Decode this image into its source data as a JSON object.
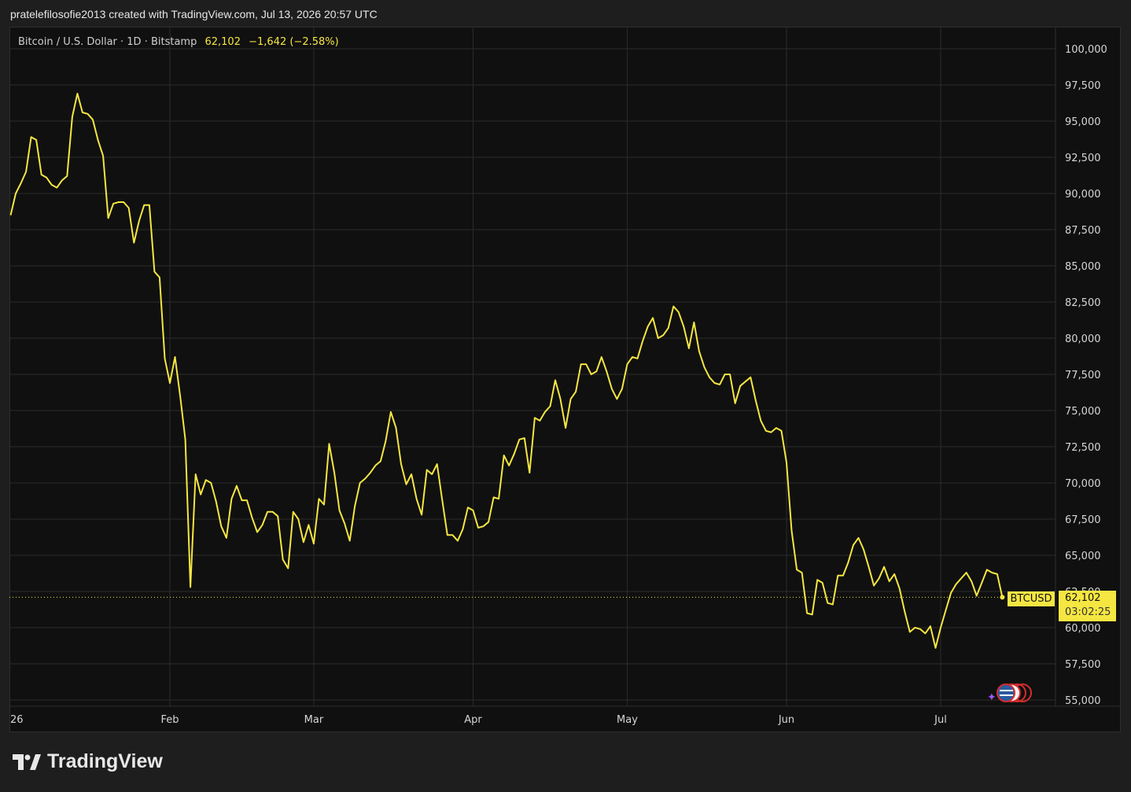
{
  "header": {
    "attribution": "pratelefilosofie2013 created with TradingView.com, Jul 13, 2026 20:57 UTC"
  },
  "legend": {
    "symbol_desc": "Bitcoin / U.S. Dollar · 1D · Bitstamp",
    "last_price": "62,102",
    "change": "−1,642 (−2.58%)"
  },
  "price_tag": {
    "symbol": "BTCUSD",
    "price": "62,102",
    "countdown": "03:02:25"
  },
  "footer": {
    "brand": "TradingView"
  },
  "colors": {
    "line": "#f5e642",
    "background": "#101010",
    "grid": "#2b2b2b"
  },
  "chart_data": {
    "type": "line",
    "title": "Bitcoin / U.S. Dollar · 1D · Bitstamp",
    "ylim": [
      55000,
      100000
    ],
    "yticks": [
      {
        "label": "100,000",
        "value": 100000
      },
      {
        "label": "97,500",
        "value": 97500
      },
      {
        "label": "95,000",
        "value": 95000
      },
      {
        "label": "92,500",
        "value": 92500
      },
      {
        "label": "90,000",
        "value": 90000
      },
      {
        "label": "87,500",
        "value": 87500
      },
      {
        "label": "85,000",
        "value": 85000
      },
      {
        "label": "82,500",
        "value": 82500
      },
      {
        "label": "80,000",
        "value": 80000
      },
      {
        "label": "77,500",
        "value": 77500
      },
      {
        "label": "75,000",
        "value": 75000
      },
      {
        "label": "72,500",
        "value": 72500
      },
      {
        "label": "70,000",
        "value": 70000
      },
      {
        "label": "67,500",
        "value": 67500
      },
      {
        "label": "65,000",
        "value": 65000
      },
      {
        "label": "62,500",
        "value": 62500
      },
      {
        "label": "60,000",
        "value": 60000
      },
      {
        "label": "57,500",
        "value": 57500
      },
      {
        "label": "55,000",
        "value": 55000
      }
    ],
    "xticks": [
      {
        "label": "26",
        "day": 0
      },
      {
        "label": "Feb",
        "day": 31
      },
      {
        "label": "Mar",
        "day": 59
      },
      {
        "label": "Apr",
        "day": 90
      },
      {
        "label": "May",
        "day": 120
      },
      {
        "label": "Jun",
        "day": 151
      },
      {
        "label": "Jul",
        "day": 181
      }
    ],
    "last_value": 62102,
    "series": [
      {
        "values": [
          [
            0,
            88500
          ],
          [
            1,
            90000
          ],
          [
            2,
            90700
          ],
          [
            3,
            91500
          ],
          [
            4,
            93900
          ],
          [
            5,
            93700
          ],
          [
            6,
            91300
          ],
          [
            7,
            91100
          ],
          [
            8,
            90600
          ],
          [
            9,
            90400
          ],
          [
            10,
            90900
          ],
          [
            11,
            91200
          ],
          [
            12,
            95300
          ],
          [
            13,
            96900
          ],
          [
            14,
            95600
          ],
          [
            15,
            95500
          ],
          [
            16,
            95100
          ],
          [
            17,
            93700
          ],
          [
            18,
            92600
          ],
          [
            19,
            88300
          ],
          [
            20,
            89300
          ],
          [
            21,
            89400
          ],
          [
            22,
            89400
          ],
          [
            23,
            89000
          ],
          [
            24,
            86600
          ],
          [
            25,
            88100
          ],
          [
            26,
            89200
          ],
          [
            27,
            89200
          ],
          [
            28,
            84600
          ],
          [
            29,
            84200
          ],
          [
            30,
            78600
          ],
          [
            31,
            76900
          ],
          [
            32,
            78700
          ],
          [
            33,
            76000
          ],
          [
            34,
            73000
          ],
          [
            35,
            62800
          ],
          [
            36,
            70600
          ],
          [
            37,
            69200
          ],
          [
            38,
            70200
          ],
          [
            39,
            70000
          ],
          [
            40,
            68700
          ],
          [
            41,
            67000
          ],
          [
            42,
            66200
          ],
          [
            43,
            68900
          ],
          [
            44,
            69800
          ],
          [
            45,
            68800
          ],
          [
            46,
            68800
          ],
          [
            47,
            67600
          ],
          [
            48,
            66600
          ],
          [
            49,
            67100
          ],
          [
            50,
            68000
          ],
          [
            51,
            68000
          ],
          [
            52,
            67700
          ],
          [
            53,
            64700
          ],
          [
            54,
            64100
          ],
          [
            55,
            68000
          ],
          [
            56,
            67500
          ],
          [
            57,
            65900
          ],
          [
            58,
            67100
          ],
          [
            59,
            65800
          ],
          [
            60,
            68900
          ],
          [
            61,
            68500
          ],
          [
            62,
            72700
          ],
          [
            63,
            70700
          ],
          [
            64,
            68100
          ],
          [
            65,
            67200
          ],
          [
            66,
            66000
          ],
          [
            67,
            68400
          ],
          [
            68,
            70000
          ],
          [
            69,
            70300
          ],
          [
            70,
            70700
          ],
          [
            71,
            71200
          ],
          [
            72,
            71500
          ],
          [
            73,
            72900
          ],
          [
            74,
            74900
          ],
          [
            75,
            73800
          ],
          [
            76,
            71300
          ],
          [
            77,
            69900
          ],
          [
            78,
            70600
          ],
          [
            79,
            68900
          ],
          [
            80,
            67800
          ],
          [
            81,
            70900
          ],
          [
            82,
            70600
          ],
          [
            83,
            71300
          ],
          [
            84,
            68800
          ],
          [
            85,
            66400
          ],
          [
            86,
            66400
          ],
          [
            87,
            66000
          ],
          [
            88,
            66800
          ],
          [
            89,
            68300
          ],
          [
            90,
            68100
          ],
          [
            91,
            66900
          ],
          [
            92,
            67000
          ],
          [
            93,
            67300
          ],
          [
            94,
            69000
          ],
          [
            95,
            68900
          ],
          [
            96,
            71900
          ],
          [
            97,
            71200
          ],
          [
            98,
            72000
          ],
          [
            99,
            73000
          ],
          [
            100,
            73100
          ],
          [
            101,
            70700
          ],
          [
            102,
            74500
          ],
          [
            103,
            74300
          ],
          [
            104,
            74900
          ],
          [
            105,
            75300
          ],
          [
            106,
            77100
          ],
          [
            107,
            75800
          ],
          [
            108,
            73800
          ],
          [
            109,
            75800
          ],
          [
            110,
            76300
          ],
          [
            111,
            78200
          ],
          [
            112,
            78200
          ],
          [
            113,
            77500
          ],
          [
            114,
            77700
          ],
          [
            115,
            78700
          ],
          [
            116,
            77700
          ],
          [
            117,
            76500
          ],
          [
            118,
            75800
          ],
          [
            119,
            76500
          ],
          [
            120,
            78200
          ],
          [
            121,
            78700
          ],
          [
            122,
            78600
          ],
          [
            123,
            79800
          ],
          [
            124,
            80800
          ],
          [
            125,
            81400
          ],
          [
            126,
            80000
          ],
          [
            127,
            80200
          ],
          [
            128,
            80700
          ],
          [
            129,
            82200
          ],
          [
            130,
            81800
          ],
          [
            131,
            80800
          ],
          [
            132,
            79300
          ],
          [
            133,
            81100
          ],
          [
            134,
            79100
          ],
          [
            135,
            78000
          ],
          [
            136,
            77300
          ],
          [
            137,
            76900
          ],
          [
            138,
            76800
          ],
          [
            139,
            77500
          ],
          [
            140,
            77500
          ],
          [
            141,
            75500
          ],
          [
            142,
            76700
          ],
          [
            143,
            77000
          ],
          [
            144,
            77300
          ],
          [
            145,
            75700
          ],
          [
            146,
            74300
          ],
          [
            147,
            73600
          ],
          [
            148,
            73500
          ],
          [
            149,
            73800
          ],
          [
            150,
            73600
          ],
          [
            151,
            71400
          ],
          [
            152,
            66700
          ],
          [
            153,
            64000
          ],
          [
            154,
            63800
          ],
          [
            155,
            61000
          ],
          [
            156,
            60900
          ],
          [
            157,
            63300
          ],
          [
            158,
            63100
          ],
          [
            159,
            61700
          ],
          [
            160,
            61600
          ],
          [
            161,
            63600
          ],
          [
            162,
            63600
          ],
          [
            163,
            64500
          ],
          [
            164,
            65700
          ],
          [
            165,
            66200
          ],
          [
            166,
            65400
          ],
          [
            167,
            64200
          ],
          [
            168,
            62900
          ],
          [
            169,
            63400
          ],
          [
            170,
            64200
          ],
          [
            171,
            63200
          ],
          [
            172,
            63700
          ],
          [
            173,
            62700
          ],
          [
            174,
            61100
          ],
          [
            175,
            59700
          ],
          [
            176,
            60000
          ],
          [
            177,
            59900
          ],
          [
            178,
            59600
          ],
          [
            179,
            60100
          ],
          [
            180,
            58600
          ],
          [
            181,
            60000
          ],
          [
            182,
            61200
          ],
          [
            183,
            62400
          ],
          [
            184,
            63000
          ],
          [
            185,
            63400
          ],
          [
            186,
            63800
          ],
          [
            187,
            63200
          ],
          [
            188,
            62200
          ],
          [
            189,
            63100
          ],
          [
            190,
            64000
          ],
          [
            191,
            63800
          ],
          [
            192,
            63700
          ],
          [
            193,
            62100
          ]
        ]
      }
    ]
  }
}
